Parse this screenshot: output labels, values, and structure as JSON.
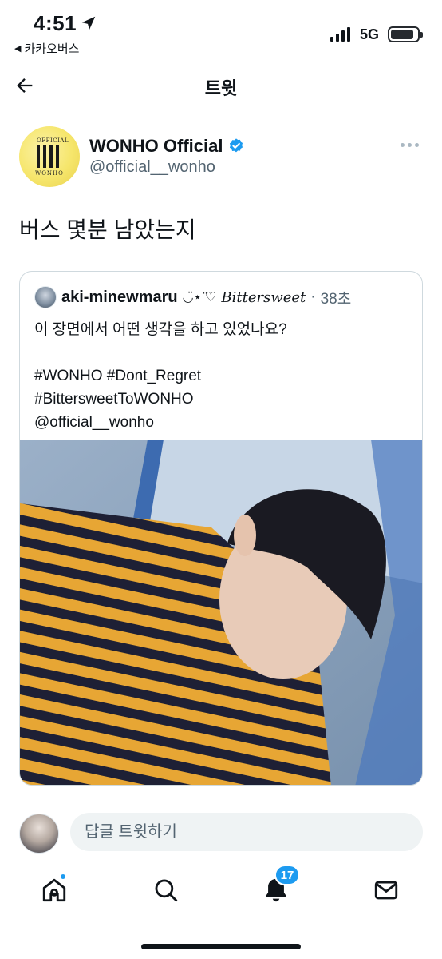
{
  "status_bar": {
    "time": "4:51",
    "back_app": "카카오버스",
    "network": "5G"
  },
  "header": {
    "title": "트윗"
  },
  "tweet": {
    "author_name": "WONHO Official",
    "author_handle": "@official__wonho",
    "text": "버스 몇분 남았는지",
    "avatar_text_top": "OFFICIAL",
    "avatar_text_bottom": "WONHO"
  },
  "quoted_tweet": {
    "author_name": "aki-minewmaru",
    "decoration": "◡̈⋆ ̈♡",
    "bittersweet": "Bittersweet",
    "separator": "·",
    "time": "38초",
    "line1": "이 장면에서 어떤 생각을 하고 있었나요?",
    "hashtags_line1": "#WONHO  #Dont_Regret",
    "hashtags_line2": "#BittersweetToWONHO",
    "mention": "@official__wonho"
  },
  "reply": {
    "placeholder": "답글 트윗하기"
  },
  "tab_bar": {
    "notifications_count": "17"
  },
  "colors": {
    "accent": "#1d9bf0",
    "secondary_text": "#536471",
    "border": "#cfd9de",
    "stripe_yellow": "#e7a634",
    "stripe_navy": "#1e2035"
  }
}
